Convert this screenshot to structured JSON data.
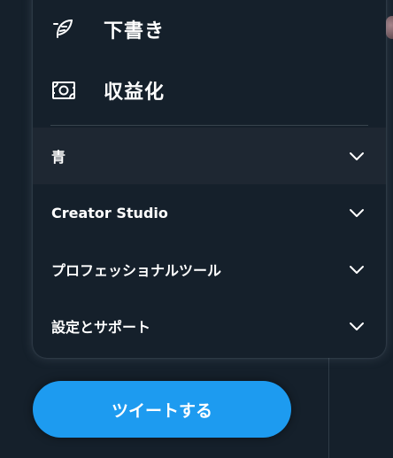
{
  "menu": {
    "drafts_label": "下書き",
    "monetize_label": "収益化",
    "sections": [
      {
        "label": "青",
        "expanded": false
      },
      {
        "label": "Creator Studio",
        "expanded": false
      },
      {
        "label": "プロフェッショナルツール",
        "expanded": false
      },
      {
        "label": "設定とサポート",
        "expanded": false
      }
    ]
  },
  "tweet_button": {
    "label": "ツイートする"
  },
  "colors": {
    "background": "#15202b",
    "menu_hover": "#1e2732",
    "accent": "#1d9bf0",
    "separator": "#38444d",
    "text": "#ffffff"
  },
  "icons": {
    "drafts": "feather-icon",
    "monetize": "money-icon",
    "expand": "chevron-down-icon"
  }
}
